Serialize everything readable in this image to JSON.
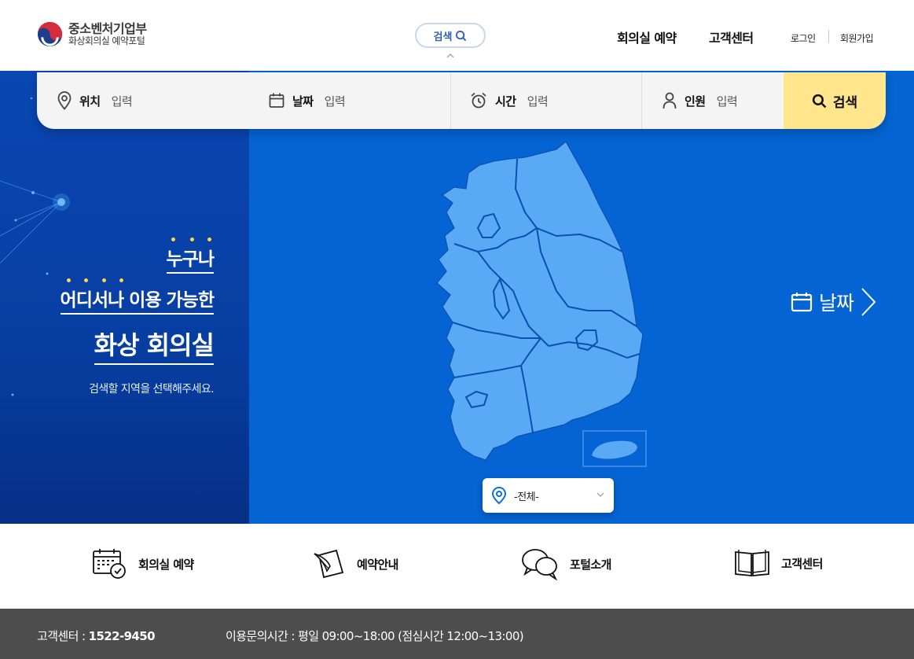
{
  "header": {
    "logo_title": "중소벤처기업부",
    "logo_sub": "화상회의실 예약포털",
    "search_toggle": "검색",
    "nav": [
      "회의실 예약",
      "고객센터"
    ],
    "util": [
      "로그인",
      "회원가입"
    ]
  },
  "search_bar": {
    "fields": [
      {
        "label": "위치",
        "value": "입력",
        "icon": "location-pin-icon"
      },
      {
        "label": "날짜",
        "value": "입력",
        "icon": "calendar-icon"
      },
      {
        "label": "시간",
        "value": "입력",
        "icon": "alarm-clock-icon"
      },
      {
        "label": "인원",
        "value": "입력",
        "icon": "person-icon"
      }
    ],
    "button": "검색"
  },
  "hero": {
    "line1": "누구나",
    "line2": "어디서나 이용 가능한",
    "line3": "화상 회의실",
    "desc": "검색할 지역을 선택해주세요.",
    "next_step": "날짜",
    "region_select_value": "-전체-"
  },
  "quick_links": [
    {
      "label": "회의실 예약",
      "icon": "calendar-check-icon"
    },
    {
      "label": "예약안내",
      "icon": "note-pen-icon"
    },
    {
      "label": "포털소개",
      "icon": "chat-bubbles-icon"
    },
    {
      "label": "고객센터",
      "icon": "open-book-icon"
    }
  ],
  "footer": {
    "cs_label": "고객센터 :",
    "cs_phone": "1522-9450",
    "hours_label": "이용문의시간 :",
    "hours_value": "평일 09:00~18:00 (점심시간 12:00~13:00)"
  },
  "colors": {
    "hero_blue": "#0564d3",
    "map_fill": "#5aa9f5",
    "search_button": "#ffe68c",
    "footer_bg": "#4d4d4d"
  }
}
